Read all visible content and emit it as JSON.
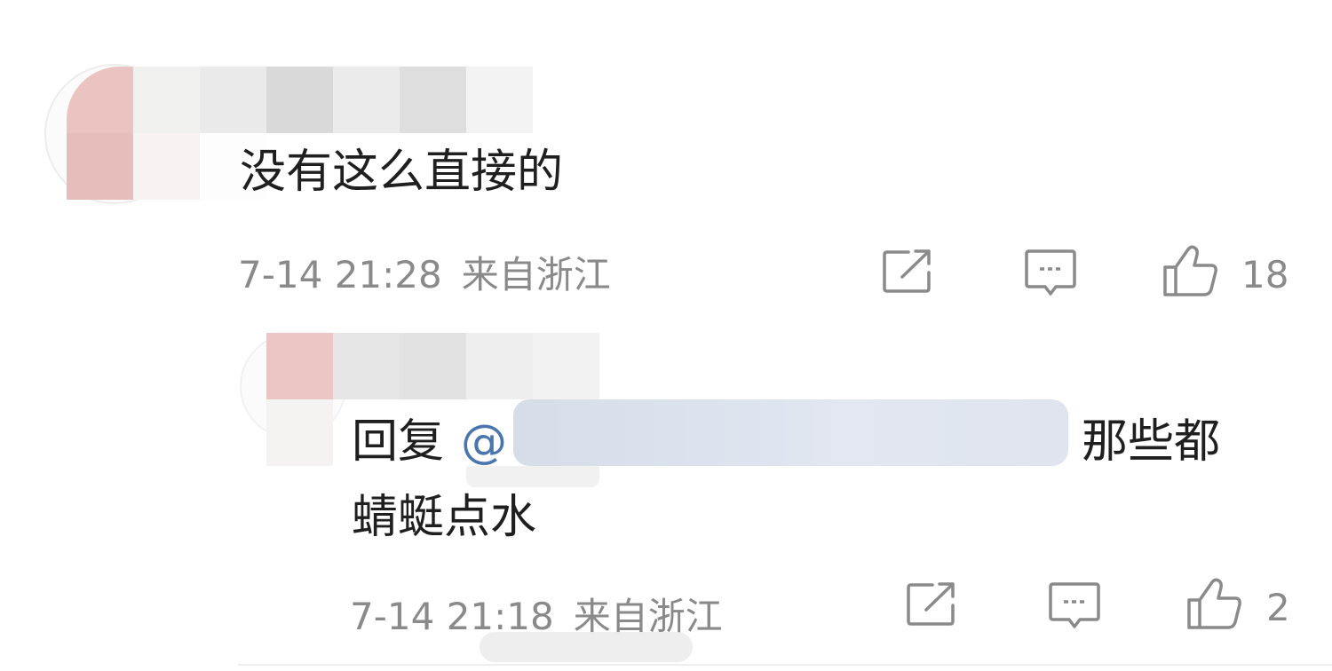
{
  "comments": [
    {
      "text": "没有这么直接的",
      "date": "7-14",
      "time": "21:28",
      "location": "来自浙江",
      "like_count": "18"
    },
    {
      "reply_prefix": "回复",
      "mention_symbol": "@",
      "text_line1": "那些都",
      "text_line2": "蜻蜓点水",
      "date": "7-14",
      "time": "21:18",
      "location": "来自浙江",
      "like_count": "2"
    }
  ],
  "icons": {
    "share": "share-icon",
    "comment": "comment-icon",
    "like": "thumbs-up-icon"
  },
  "colors": {
    "meta_text": "#8a8a8a",
    "body_text": "#1f1f1f",
    "mention": "#4a76b0",
    "icon_stroke": "#8a8a8a"
  }
}
